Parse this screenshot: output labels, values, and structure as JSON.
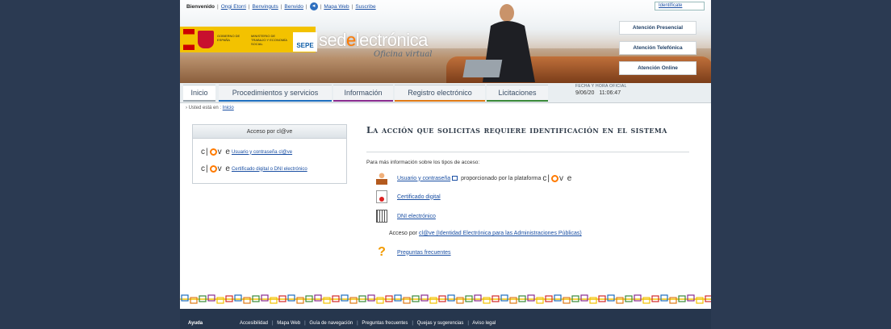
{
  "header": {
    "top_links": [
      "Bienvenido",
      "Ongi Etorri",
      "Benvinguts",
      "Benvido",
      "Mapa Web",
      "Suscribe"
    ],
    "identification_button": "Identifícate",
    "logo_gobierno": "GOBIERNO DE ESPAÑA",
    "logo_ministerio": "MINISTERIO DE TRABAJO Y ECONOMÍA SOCIAL",
    "sepe_logo": "SEPE",
    "brand_text_a": "sed",
    "brand_text_e": "e",
    "brand_text_b": "lectrónica",
    "tagline": "Oficina virtual",
    "attention_buttons": [
      "Atención Presencial",
      "Atención Telefónica",
      "Atención Online"
    ]
  },
  "nav": {
    "tabs": [
      {
        "label": "Inicio",
        "color": "#9aa5ad"
      },
      {
        "label": "Procedimientos y servicios",
        "color": "#1f6fbf"
      },
      {
        "label": "Información",
        "color": "#8a2c8f"
      },
      {
        "label": "Registro electrónico",
        "color": "#e07a16"
      },
      {
        "label": "Licitaciones",
        "color": "#3a8a3a"
      }
    ],
    "fecha_label": "FECHA Y HORA OFICIAL",
    "fecha_date": "9/06/20",
    "fecha_time": "11:06:47"
  },
  "breadcrumb": {
    "prefix": "› Usted está en :",
    "current": "Inicio"
  },
  "acceso_box": {
    "title": "Acceso por cl@ve",
    "items": [
      "Usuario y contraseña cl@ve",
      "Certificado digital o DNI electrónico"
    ]
  },
  "main": {
    "title": "La acción que solicitas requiere identificación en el sistema",
    "intro": "Para más información sobre los tipos de acceso:",
    "rows": {
      "usuario_link": "Usuario y contraseña",
      "usuario_text": "proporcionado por la plataforma",
      "certificado": "Certificado digital",
      "dni": "DNI electrónico",
      "acceso_prefix": "Acceso por",
      "acceso_link": "cl@ve (Identidad Electrónica para las Administraciones Públicas)",
      "faq": "Preguntas frecuentes"
    }
  },
  "footer": {
    "ayuda": "Ayuda",
    "links": [
      "Accesibilidad",
      "Mapa Web",
      "Guía de navegación",
      "Preguntas frecuentes",
      "Quejas y sugerencias",
      "Aviso legal"
    ]
  },
  "colors": {
    "background": "#2b3a52",
    "accent_orange": "#ff7a00",
    "link": "#1a4fa3",
    "footer": "#26364d"
  }
}
